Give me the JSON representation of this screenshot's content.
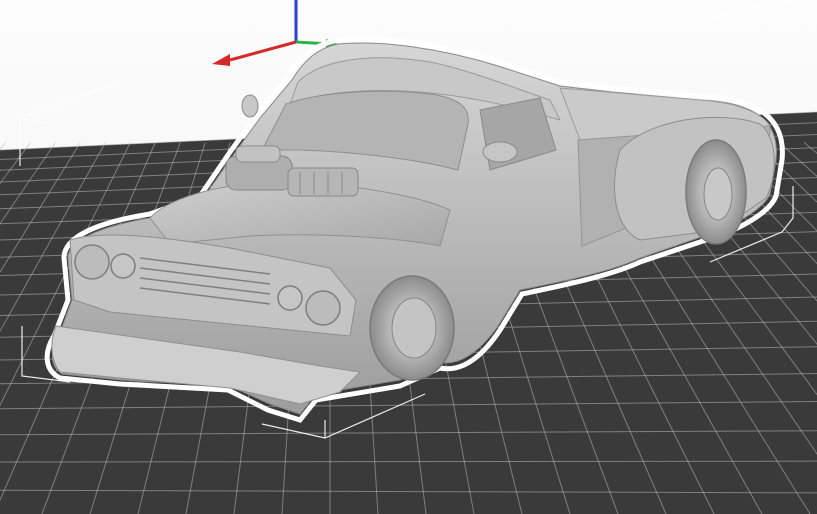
{
  "viewport": {
    "view_name": "3D preview",
    "background_color": "#f6f6f6",
    "bed_color": "#3a3a3a",
    "grid_color": "#b8b8b8",
    "model_color": "#bdbdbd",
    "selection_outline_color": "#ffffff",
    "axis_colors": {
      "x": "#d42a2a",
      "y": "#2bb24a",
      "z": "#2a3fd6"
    }
  },
  "model": {
    "name": "",
    "selected": true,
    "icons": [
      "pickup-truck-icon"
    ]
  }
}
